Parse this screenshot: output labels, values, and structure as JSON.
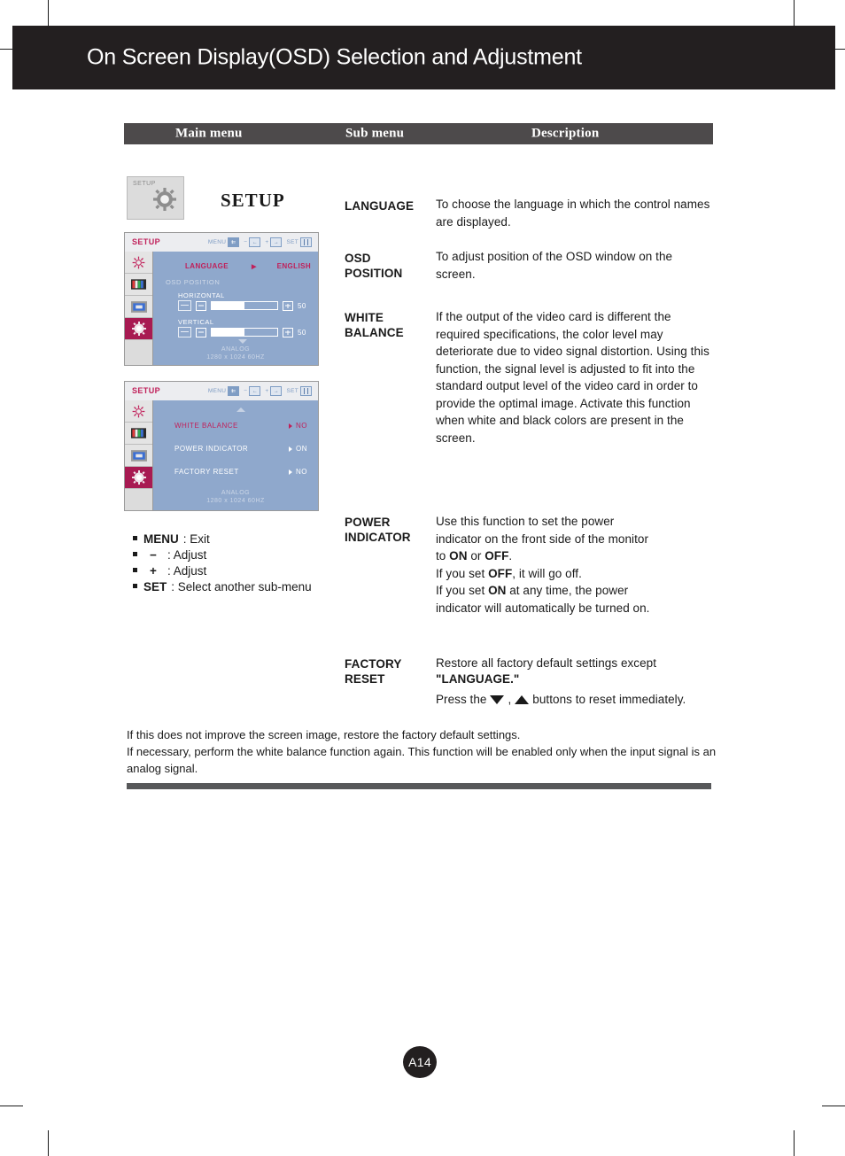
{
  "header": {
    "title": "On Screen Display(OSD) Selection and Adjustment"
  },
  "table_header": {
    "main_menu": "Main menu",
    "sub_menu": "Sub menu",
    "description": "Description"
  },
  "setup": {
    "box_label": "SETUP",
    "heading": "SETUP",
    "gear_icon": "gear-icon"
  },
  "osd1": {
    "name": "SETUP",
    "keys": [
      {
        "label": "MENU",
        "icon": "menu-key-icon"
      },
      {
        "label": "−",
        "icon": "minus-key-icon"
      },
      {
        "label": "+",
        "icon": "plus-key-icon"
      },
      {
        "label": "SET",
        "icon": "set-key-icon"
      }
    ],
    "side_icons": [
      "brightness-icon",
      "color-icon",
      "tracking-icon",
      "setup-gear-icon"
    ],
    "language_row": {
      "label": "LANGUAGE",
      "value": "ENGLISH"
    },
    "osd_position_label": "OSD  POSITION",
    "horizontal": {
      "label": "HORIZONTAL",
      "value": "50",
      "percent": 50
    },
    "vertical": {
      "label": "VERTICAL",
      "value": "50",
      "percent": 50
    },
    "footer_line1": "ANALOG",
    "footer_line2": "1280 x 1024  60HZ"
  },
  "osd2": {
    "name": "SETUP",
    "keys": [
      {
        "label": "MENU",
        "icon": "menu-key-icon"
      },
      {
        "label": "−",
        "icon": "minus-key-icon"
      },
      {
        "label": "+",
        "icon": "plus-key-icon"
      },
      {
        "label": "SET",
        "icon": "set-key-icon"
      }
    ],
    "side_icons": [
      "brightness-icon",
      "color-icon",
      "tracking-icon",
      "setup-gear-icon"
    ],
    "rows": [
      {
        "label": "WHITE  BALANCE",
        "value": "NO"
      },
      {
        "label": "POWER  INDICATOR",
        "value": "ON"
      },
      {
        "label": "FACTORY  RESET",
        "value": "NO"
      }
    ],
    "footer_line1": "ANALOG",
    "footer_line2": "1280 x 1024  60HZ"
  },
  "legend": [
    {
      "key": "MENU",
      "sym": "",
      "text": ": Exit"
    },
    {
      "key": "",
      "sym": "−",
      "text": ": Adjust"
    },
    {
      "key": "",
      "sym": "+",
      "text": ": Adjust"
    },
    {
      "key": "SET",
      "sym": "",
      "text": ": Select another sub-menu"
    }
  ],
  "rows": {
    "language": {
      "sub_menu": "LANGUAGE",
      "description": "To choose the language in which the control names are displayed."
    },
    "osd_position": {
      "sub_menu_line1": "OSD",
      "sub_menu_line2": "POSITION",
      "description": "To adjust position of the OSD window on the screen."
    },
    "white_balance": {
      "sub_menu_line1": "WHITE",
      "sub_menu_line2": "BALANCE",
      "description": "If the output of the video card is different the required specifications, the color level may deteriorate due to video signal distortion. Using this function, the signal level is adjusted to fit into the standard output level of the video card in order to provide the optimal image. Activate this function when white and black colors are present in the screen."
    },
    "power_indicator": {
      "sub_menu_line1": "POWER",
      "sub_menu_line2": "INDICATOR",
      "d1a": "Use this function to set the power",
      "d1b": "indicator on the front side of the monitor",
      "d2a": "to ",
      "d2b": "ON",
      "d2c": " or ",
      "d2d": "OFF",
      "d2e": ".",
      "d3a": "If you set ",
      "d3b": "OFF",
      "d3c": ", it will go off.",
      "d4a": "If you set ",
      "d4b": "ON",
      "d4c": " at any time, the power",
      "d5": "indicator will automatically be turned on."
    },
    "factory_reset": {
      "sub_menu_line1": "FACTORY",
      "sub_menu_line2": "RESET",
      "d1": "Restore all factory default settings except",
      "d2": "\"LANGUAGE.\"",
      "d3a": "Press the",
      "d3b": ",",
      "d3c": "buttons to reset immediately.",
      "down_icon": "triangle-down-icon",
      "up_icon": "triangle-up-icon"
    }
  },
  "note": "If this does not improve the screen image, restore the factory default settings.\nIf necessary, perform the white balance function again. This function will be enabled only when the input signal is an analog signal.",
  "page_number": "A14",
  "colors": {
    "header_bg": "#231f20",
    "table_header_bg": "#4d4a4b",
    "osd_body": "#8fa8cc",
    "osd_accent": "#c0205a",
    "osd_side_active": "#a81a52",
    "footer_rule": "#57585a"
  }
}
